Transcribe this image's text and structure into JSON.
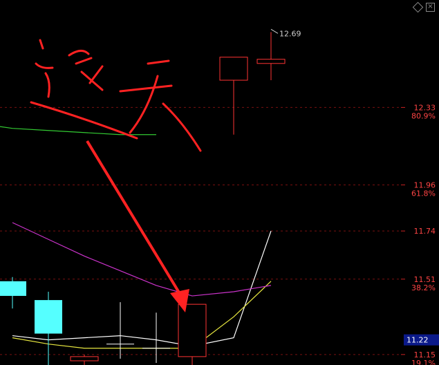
{
  "window_controls": {
    "pin_icon": "diamond-icon",
    "close_label": "×"
  },
  "chart_data": {
    "type": "candlestick",
    "title": "",
    "ylim": [
      11.1,
      12.81
    ],
    "grid": "horizontal dashed red",
    "price_levels": [
      {
        "price": 12.33,
        "label": "12.33",
        "fib": "80.9%"
      },
      {
        "price": 11.96,
        "label": "11.96",
        "fib": "61.8%"
      },
      {
        "price": 11.74,
        "label": "11.74",
        "fib": ""
      },
      {
        "price": 11.51,
        "label": "11.51",
        "fib": "38.2%"
      },
      {
        "price": 11.15,
        "label": "11.15",
        "fib": "19.1%"
      }
    ],
    "current_price": {
      "value": 11.22,
      "label": "11.22"
    },
    "high_marker": {
      "value": 12.69,
      "label": "12.69"
    },
    "candles": [
      {
        "open": 11.43,
        "high": 11.52,
        "low": 11.37,
        "close": 11.5,
        "color": "#5ff"
      },
      {
        "open": 11.25,
        "high": 11.45,
        "low": 11.1,
        "close": 11.41,
        "color": "#5ff"
      },
      {
        "open": 11.12,
        "high": 11.15,
        "low": 11.1,
        "close": 11.14,
        "color": "#f33",
        "hollow": true
      },
      {
        "open": 11.2,
        "high": 11.4,
        "low": 11.13,
        "close": 11.2,
        "color": "#fff"
      },
      {
        "open": 11.18,
        "high": 11.35,
        "low": 11.11,
        "close": 11.18,
        "color": "#fff"
      },
      {
        "open": 11.14,
        "high": 11.39,
        "low": 11.1,
        "close": 11.39,
        "color": "#f33",
        "hollow": true
      },
      {
        "open": 12.46,
        "high": 12.46,
        "low": 12.2,
        "close": 12.57,
        "color": "#f33",
        "hollow": true
      },
      {
        "open": 12.54,
        "high": 12.69,
        "low": 12.46,
        "close": 12.56,
        "color": "#f33",
        "hollow": true
      }
    ],
    "series": [
      {
        "color": "#ffffff",
        "values": [
          11.24,
          11.22,
          11.23,
          11.24,
          11.22,
          11.19,
          11.23,
          11.74
        ]
      },
      {
        "color": "#e8e840",
        "values": [
          11.23,
          11.2,
          11.18,
          11.18,
          11.18,
          11.18,
          11.33,
          11.5
        ]
      },
      {
        "color": "#cc33cc",
        "values": [
          11.78,
          11.7,
          11.62,
          11.55,
          11.48,
          11.43,
          11.45,
          11.48
        ]
      },
      {
        "color": "#33cc33",
        "values": [
          12.27,
          12.26,
          12.25,
          12.23,
          12.22,
          12.21,
          12.2,
          12.2
        ],
        "start_offset": -3
      }
    ]
  },
  "annotation": {
    "handwritten_text": "这天",
    "color": "#ff2222"
  }
}
